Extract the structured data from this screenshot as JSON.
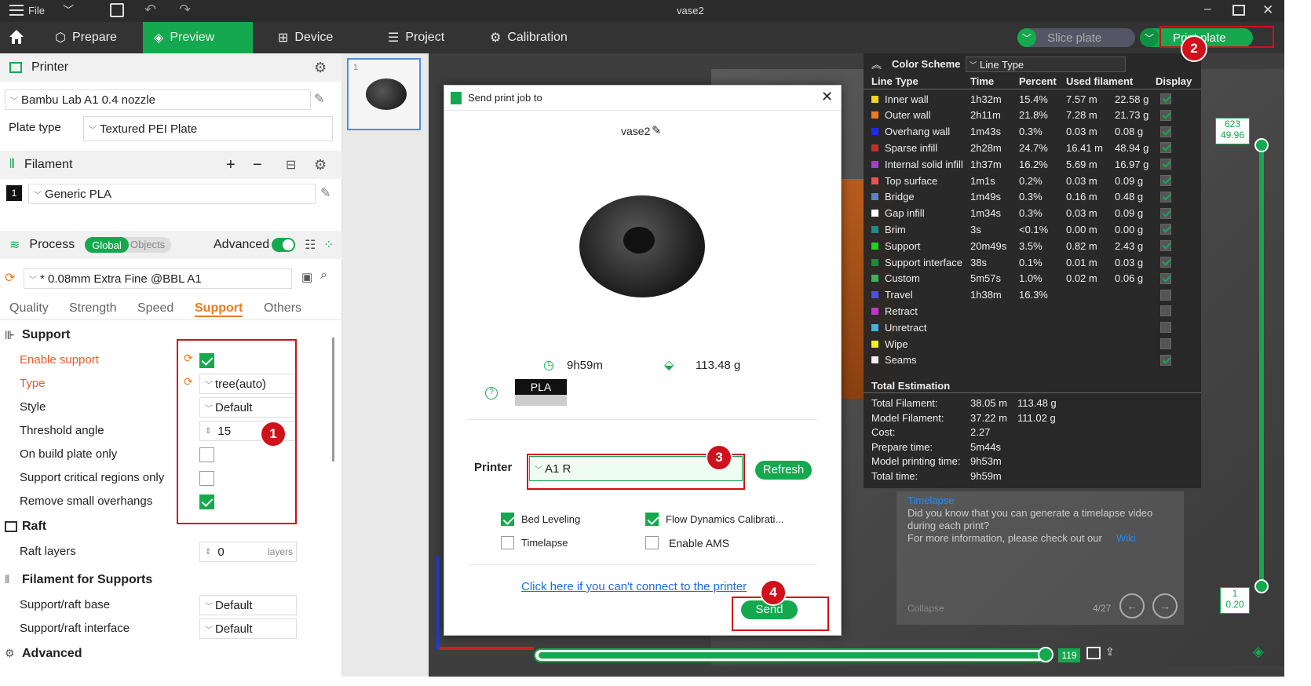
{
  "window": {
    "title": "vase2",
    "file_menu": "File"
  },
  "nav": {
    "tabs": [
      "Prepare",
      "Preview",
      "Device",
      "Project",
      "Calibration"
    ],
    "slice_plate": "Slice plate",
    "print_plate": "Print plate"
  },
  "printer_section": {
    "title": "Printer",
    "printer_name": "Bambu Lab A1 0.4 nozzle",
    "plate_type_label": "Plate type",
    "plate_type": "Textured PEI Plate"
  },
  "filament_section": {
    "title": "Filament",
    "slot": "1",
    "filament": "Generic PLA"
  },
  "process_section": {
    "title": "Process",
    "global": "Global",
    "objects": "Objects",
    "advanced": "Advanced",
    "preset": "* 0.08mm Extra Fine @BBL A1"
  },
  "tabs": [
    "Quality",
    "Strength",
    "Speed",
    "Support",
    "Others"
  ],
  "support": {
    "title": "Support",
    "enable_label": "Enable support",
    "type_label": "Type",
    "type_value": "tree(auto)",
    "style_label": "Style",
    "style_value": "Default",
    "threshold_label": "Threshold angle",
    "threshold_value": "15",
    "build_plate_label": "On build plate only",
    "critical_label": "Support critical regions only",
    "remove_label": "Remove small overhangs"
  },
  "raft": {
    "title": "Raft",
    "layers_label": "Raft layers",
    "layers_value": "0",
    "layers_unit": "layers"
  },
  "filament_supports": {
    "title": "Filament for Supports",
    "base_label": "Support/raft base",
    "base_value": "Default",
    "interface_label": "Support/raft interface",
    "interface_value": "Default"
  },
  "advanced_section": {
    "title": "Advanced"
  },
  "badges": [
    "1",
    "2",
    "3",
    "4"
  ],
  "thumb_number": "1",
  "legend": {
    "title": "Color Scheme",
    "scheme": "Line Type",
    "headers": [
      "Line Type",
      "Time",
      "Percent",
      "Used filament",
      "Display"
    ],
    "rows": [
      {
        "name": "Inner wall",
        "color": "#f5d21e",
        "time": "1h32m",
        "pct": "15.4%",
        "m": "7.57 m",
        "g": "22.58 g",
        "on": true
      },
      {
        "name": "Outer wall",
        "color": "#f07a1e",
        "time": "2h11m",
        "pct": "21.8%",
        "m": "7.28 m",
        "g": "21.73 g",
        "on": true
      },
      {
        "name": "Overhang wall",
        "color": "#1e2af0",
        "time": "1m43s",
        "pct": "0.3%",
        "m": "0.03 m",
        "g": "0.08 g",
        "on": true
      },
      {
        "name": "Sparse infill",
        "color": "#c0302a",
        "time": "2h28m",
        "pct": "24.7%",
        "m": "16.41 m",
        "g": "48.94 g",
        "on": true
      },
      {
        "name": "Internal solid infill",
        "color": "#a040c8",
        "time": "1h37m",
        "pct": "16.2%",
        "m": "5.69 m",
        "g": "16.97 g",
        "on": true
      },
      {
        "name": "Top surface",
        "color": "#f05050",
        "time": "1m1s",
        "pct": "0.2%",
        "m": "0.03 m",
        "g": "0.09 g",
        "on": true
      },
      {
        "name": "Bridge",
        "color": "#5a82c8",
        "time": "1m49s",
        "pct": "0.3%",
        "m": "0.16 m",
        "g": "0.48 g",
        "on": true
      },
      {
        "name": "Gap infill",
        "color": "#ffffff",
        "time": "1m34s",
        "pct": "0.3%",
        "m": "0.03 m",
        "g": "0.09 g",
        "on": true
      },
      {
        "name": "Brim",
        "color": "#1e8a8a",
        "time": "3s",
        "pct": "<0.1%",
        "m": "0.00 m",
        "g": "0.00 g",
        "on": true
      },
      {
        "name": "Support",
        "color": "#1ed21e",
        "time": "20m49s",
        "pct": "3.5%",
        "m": "0.82 m",
        "g": "2.43 g",
        "on": true
      },
      {
        "name": "Support interface",
        "color": "#1e8a3c",
        "time": "38s",
        "pct": "0.1%",
        "m": "0.01 m",
        "g": "0.03 g",
        "on": true
      },
      {
        "name": "Custom",
        "color": "#3cb45a",
        "time": "5m57s",
        "pct": "1.0%",
        "m": "0.02 m",
        "g": "0.06 g",
        "on": true
      },
      {
        "name": "Travel",
        "color": "#5050e0",
        "time": "1h38m",
        "pct": "16.3%",
        "m": "",
        "g": "",
        "on": false
      },
      {
        "name": "Retract",
        "color": "#c832c8",
        "time": "",
        "pct": "",
        "m": "",
        "g": "",
        "on": false
      },
      {
        "name": "Unretract",
        "color": "#3cb4dc",
        "time": "",
        "pct": "",
        "m": "",
        "g": "",
        "on": false
      },
      {
        "name": "Wipe",
        "color": "#f0f01e",
        "time": "",
        "pct": "",
        "m": "",
        "g": "",
        "on": false
      },
      {
        "name": "Seams",
        "color": "#f0f0f0",
        "time": "",
        "pct": "",
        "m": "",
        "g": "",
        "on": true
      }
    ],
    "total_title": "Total Estimation",
    "totals": [
      {
        "label": "Total Filament:",
        "v1": "38.05 m",
        "v2": "113.48 g"
      },
      {
        "label": "Model Filament:",
        "v1": "37.22 m",
        "v2": "111.02 g"
      },
      {
        "label": "Cost:",
        "v1": "2.27",
        "v2": ""
      },
      {
        "label": "Prepare time:",
        "v1": "5m44s",
        "v2": ""
      },
      {
        "label": "Model printing time:",
        "v1": "9h53m",
        "v2": ""
      },
      {
        "label": "Total time:",
        "v1": "9h59m",
        "v2": ""
      }
    ]
  },
  "tip": {
    "title": "Timelapse",
    "line1": "Did you know that you can generate a timelapse video",
    "line2": "during each print?",
    "line3": "For more information, please check out our",
    "link": "Wiki",
    "collapse": "Collapse",
    "page": "4/27"
  },
  "slider": {
    "top_layer": "623",
    "top_height": "49.96",
    "bottom_layer": "1",
    "bottom_height": "0.20",
    "h_value": "119"
  },
  "dialog": {
    "title": "Send print job to",
    "job_name": "vase2",
    "time": "9h59m",
    "weight": "113.48 g",
    "filament_type": "PLA",
    "printer_label": "Printer",
    "printer_value": "A1 R",
    "refresh": "Refresh",
    "bed_leveling": "Bed Leveling",
    "flow_calibration": "Flow Dynamics Calibrati...",
    "timelapse": "Timelapse",
    "enable_ams": "Enable AMS",
    "connect_link": "Click here if you can't connect to the printer",
    "send": "Send"
  }
}
